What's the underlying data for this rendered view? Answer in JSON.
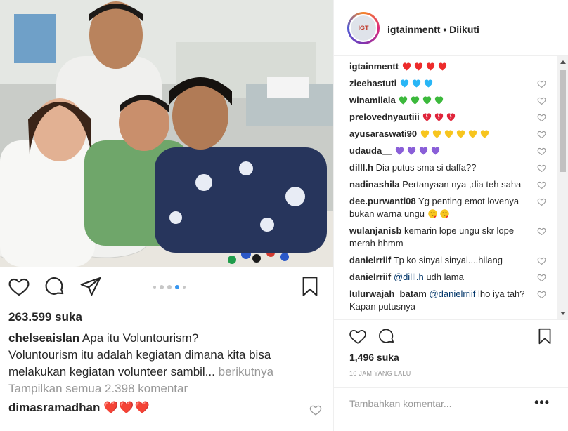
{
  "post": {
    "likes": "263.599 suka",
    "caption_user": "chelseaislan",
    "caption_line1": "Apa itu Voluntourism?",
    "caption_line2": "Voluntourism itu adalah kegiatan dimana kita bisa",
    "caption_line3": "melakukan kegiatan volunteer sambil...",
    "caption_more": "berikutnya",
    "view_all": "Tampilkan semua 2.398 komentar",
    "first_comment_user": "dimasramadhan",
    "first_comment_text": "❤️❤️❤️",
    "carousel": {
      "count": 5,
      "active_index": 2
    }
  },
  "panel": {
    "username": "igtainmentt",
    "separator": "•",
    "follow_status": "Diikuti",
    "avatar_text": "IGT",
    "likes": "1,496 suka",
    "time": "16 JAM YANG LALU",
    "add_comment_placeholder": "Tambahkan komentar...",
    "more_label": "•••"
  },
  "comments": [
    {
      "user": "igtainmentt",
      "emoji": "red-heart",
      "emoji_count": 4,
      "text": "",
      "likeable": false
    },
    {
      "user": "zieehastuti",
      "emoji": "blue-heart",
      "emoji_count": 3,
      "text": "",
      "likeable": true
    },
    {
      "user": "winamilala",
      "emoji": "green-heart",
      "emoji_count": 4,
      "text": "",
      "likeable": true
    },
    {
      "user": "prelovednyautiii",
      "emoji": "broken-heart",
      "emoji_count": 3,
      "text": "",
      "likeable": true
    },
    {
      "user": "ayusaraswati90",
      "emoji": "yellow-heart",
      "emoji_count": 6,
      "text": "",
      "likeable": true
    },
    {
      "user": "udauda__",
      "emoji": "purple-heart",
      "emoji_count": 4,
      "text": "",
      "likeable": true
    },
    {
      "user": "dilll.h",
      "text": "Dia putus sma si daffa??",
      "likeable": true
    },
    {
      "user": "nadinashila",
      "text": "Pertanyaan nya ,dia teh saha",
      "likeable": true
    },
    {
      "user": "dee.purwanti08",
      "text": "Yg penting emot lovenya bukan warna ungu",
      "trail_emoji": "kiss",
      "trail_count": 2,
      "likeable": true
    },
    {
      "user": "wulanjanisb",
      "text": "kemarin lope ungu skr lope merah hhmm",
      "likeable": true
    },
    {
      "user": "danielrriif",
      "text": "Tp ko sinyal sinyal....hilang",
      "likeable": true
    },
    {
      "user": "danielrriif",
      "mention": "@dilll.h",
      "text": "udh lama",
      "likeable": true
    },
    {
      "user": "lulurwajah_batam",
      "mention": "@danielrriif",
      "text": "lho iya tah? Kapan putusnya",
      "likeable": true
    }
  ],
  "colors": {
    "accent": "#3897f0",
    "heart_red": "#ed2b2b",
    "muted": "#999999",
    "text": "#262626"
  }
}
